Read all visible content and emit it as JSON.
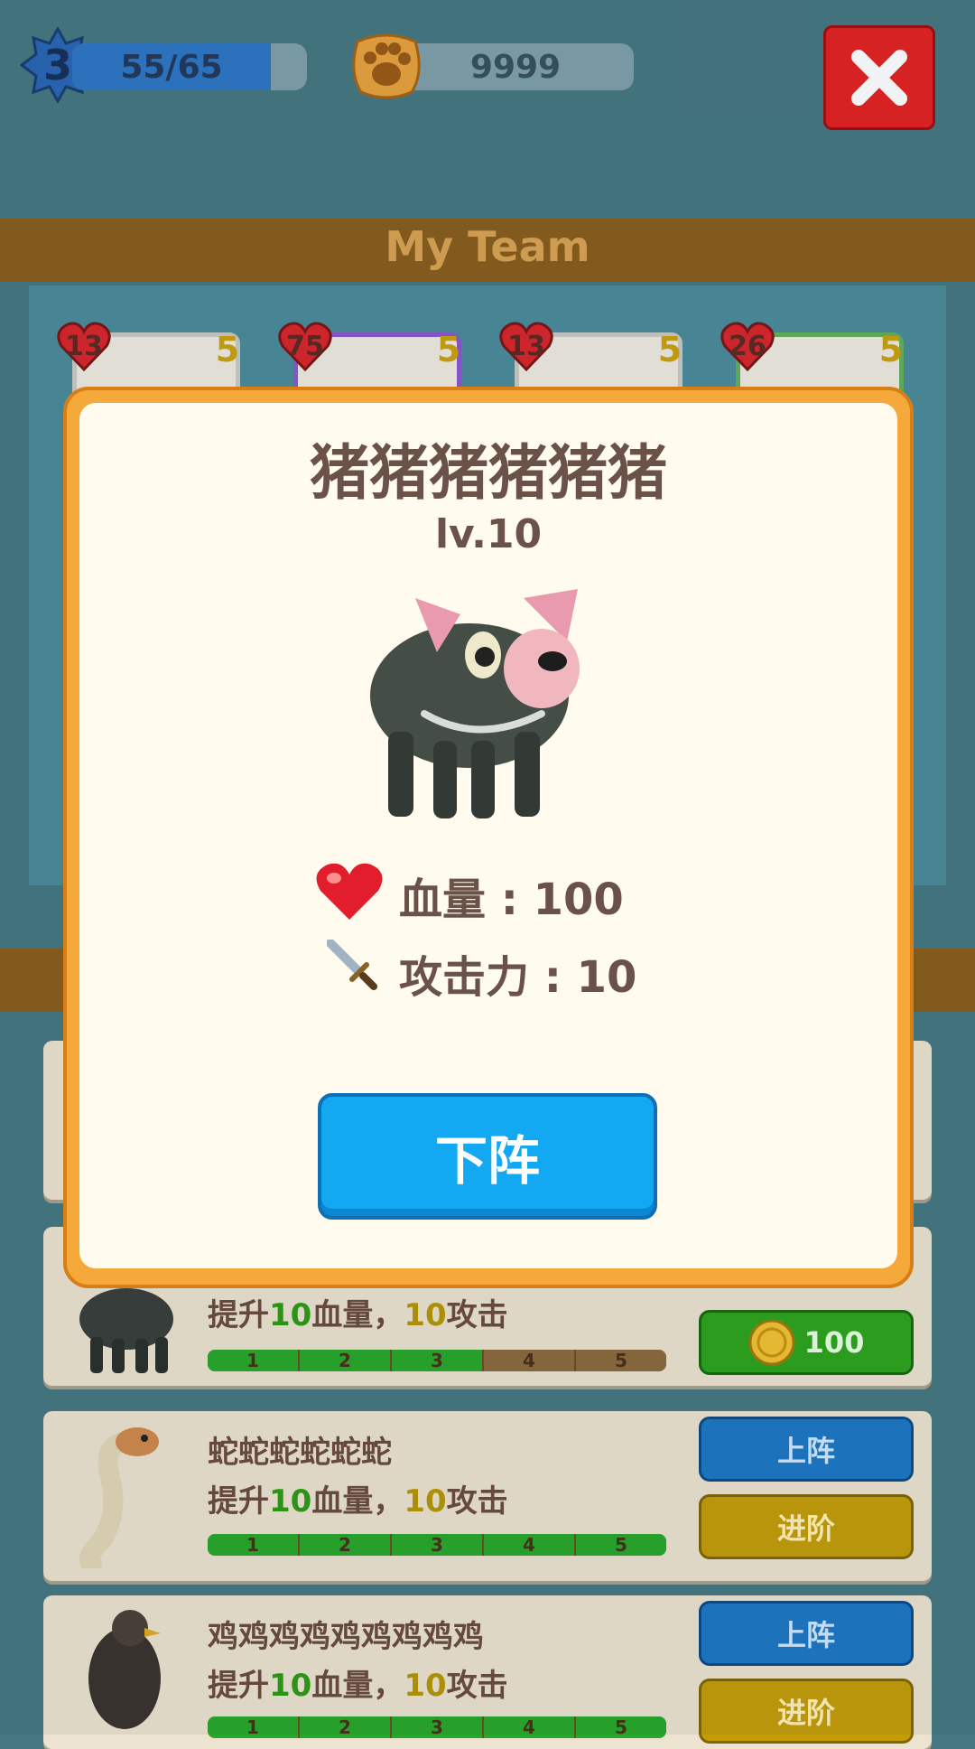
{
  "topbar": {
    "player_level": "3",
    "xp_text": "55/65",
    "xp_fraction": 0.846,
    "paw_count": "9999",
    "close_icon": "close-x-icon"
  },
  "header": {
    "title": "My Team"
  },
  "team": [
    {
      "hp": "13",
      "atk": "5",
      "frame": "gray"
    },
    {
      "hp": "75",
      "atk": "5",
      "frame": "purple"
    },
    {
      "hp": "13",
      "atk": "5",
      "frame": "gray"
    },
    {
      "hp": "26",
      "atk": "5",
      "frame": "green"
    }
  ],
  "rows": [
    {
      "title": "",
      "desc_prefix": "提升",
      "desc_hp": "10",
      "desc_mid": "血量，",
      "desc_atk": "10",
      "desc_suffix": "攻击",
      "progress_steps": [
        "1",
        "2",
        "3",
        "4",
        "5"
      ],
      "progress_filled": 3,
      "button": {
        "icon": "gold-coin-icon",
        "label": "100"
      }
    },
    {
      "title": "蛇蛇蛇蛇蛇蛇",
      "desc_prefix": "提升",
      "desc_hp": "10",
      "desc_mid": "血量，",
      "desc_atk": "10",
      "desc_suffix": "攻击",
      "progress_steps": [
        "1",
        "2",
        "3",
        "4",
        "5"
      ],
      "progress_filled": 5,
      "button_top": "上阵",
      "button_bottom": "进阶"
    },
    {
      "title": "鸡鸡鸡鸡鸡鸡鸡鸡鸡",
      "desc_prefix": "提升",
      "desc_hp": "10",
      "desc_mid": "血量，",
      "desc_atk": "10",
      "desc_suffix": "攻击",
      "progress_steps": [
        "1",
        "2",
        "3",
        "4",
        "5"
      ],
      "progress_filled": 5,
      "button_top": "上阵",
      "button_bottom": "进阶"
    }
  ],
  "modal": {
    "name": "猪猪猪猪猪猪",
    "level": "lv.10",
    "hp_label": "血量 : 100",
    "atk_label": "攻击力 : 10",
    "button": "下阵",
    "colors": {
      "frame": "#f6a93b",
      "button": "#12a9f2",
      "text": "#6b5249"
    }
  }
}
